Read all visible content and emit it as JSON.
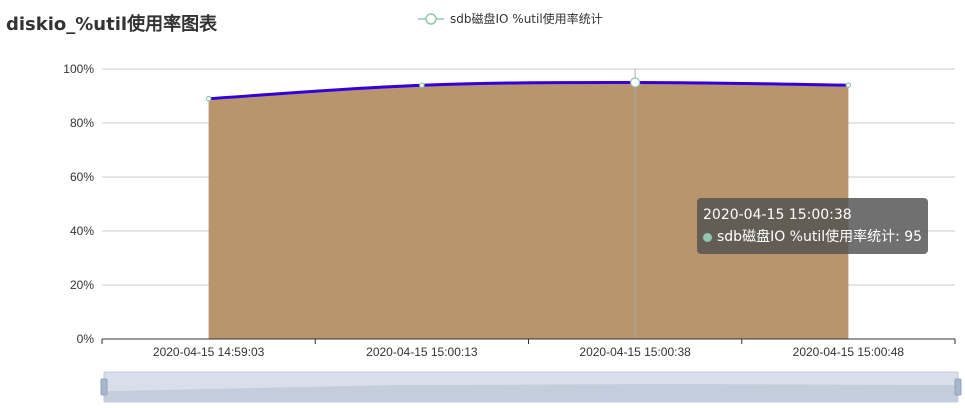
{
  "chart_data": {
    "type": "area",
    "title": "diskio_%util使用率图表",
    "categories": [
      "2020-04-15 14:59:03",
      "2020-04-15 15:00:13",
      "2020-04-15 15:00:38",
      "2020-04-15 15:00:48"
    ],
    "x": [
      "2020-04-15 14:59:03",
      "2020-04-15 15:00:13",
      "2020-04-15 15:00:38",
      "2020-04-15 15:00:48"
    ],
    "series": [
      {
        "name": "sdb磁盘IO %util使用率统计",
        "values": [
          89,
          94,
          95,
          94
        ]
      }
    ],
    "ylim": [
      0,
      100
    ],
    "yticks": [
      "0%",
      "20%",
      "40%",
      "60%",
      "80%",
      "100%"
    ],
    "grid": true,
    "legend_position": "top-center",
    "colors": {
      "line": "#3300dd",
      "area": "#b8956c",
      "marker": "#ffffff",
      "marker_stroke": "#91c7ae",
      "legend_icon": "#91c7ae",
      "tooltip_dot": "#91c7ae",
      "zoom_bg": "#d9dfec",
      "zoom_handle": "#a7b7cc"
    }
  },
  "tooltip": {
    "title": "2020-04-15 15:00:38",
    "line": "sdb磁盘IO %util使用率统计: 95",
    "index": 2
  }
}
